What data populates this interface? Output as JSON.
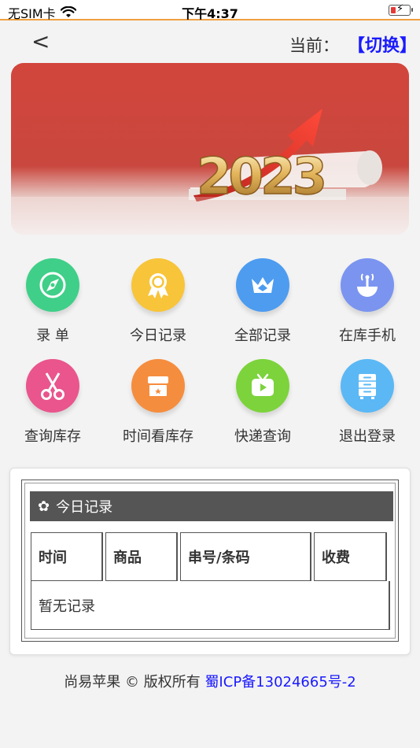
{
  "status_bar": {
    "carrier": "无SIM卡",
    "time": "下午4:37",
    "battery_color": "#e53935"
  },
  "nav": {
    "back_label": "<",
    "current_label": "当前：",
    "switch_label": "【切换】",
    "switch_color": "#1a1aff"
  },
  "banner": {
    "text": "2023",
    "background_color": "#d2463c"
  },
  "menu": [
    {
      "label": "录 单",
      "icon": "compass-icon",
      "color": "#3fcf88"
    },
    {
      "label": "今日记录",
      "icon": "award-badge-icon",
      "color": "#f8c43a"
    },
    {
      "label": "全部记录",
      "icon": "crown-icon",
      "color": "#4d9cf0"
    },
    {
      "label": "在库手机",
      "icon": "antenna-icon",
      "color": "#7a94f0"
    },
    {
      "label": "查询库存",
      "icon": "scissors-icon",
      "color": "#e9558c"
    },
    {
      "label": "时间看库存",
      "icon": "shop-icon",
      "color": "#f58d3e"
    },
    {
      "label": "快递查询",
      "icon": "tv-play-icon",
      "color": "#7cd33c"
    },
    {
      "label": "退出登录",
      "icon": "cabinet-icon",
      "color": "#5bb8f5"
    }
  ],
  "records": {
    "flower_icon": "✿",
    "title": "今日记录",
    "columns": [
      "时间",
      "商品",
      "串号/条码",
      "收费"
    ],
    "empty_text": "暂无记录"
  },
  "footer": {
    "copyright": "尚易苹果 © 版权所有",
    "icp": "蜀ICP备13024665号-2"
  }
}
